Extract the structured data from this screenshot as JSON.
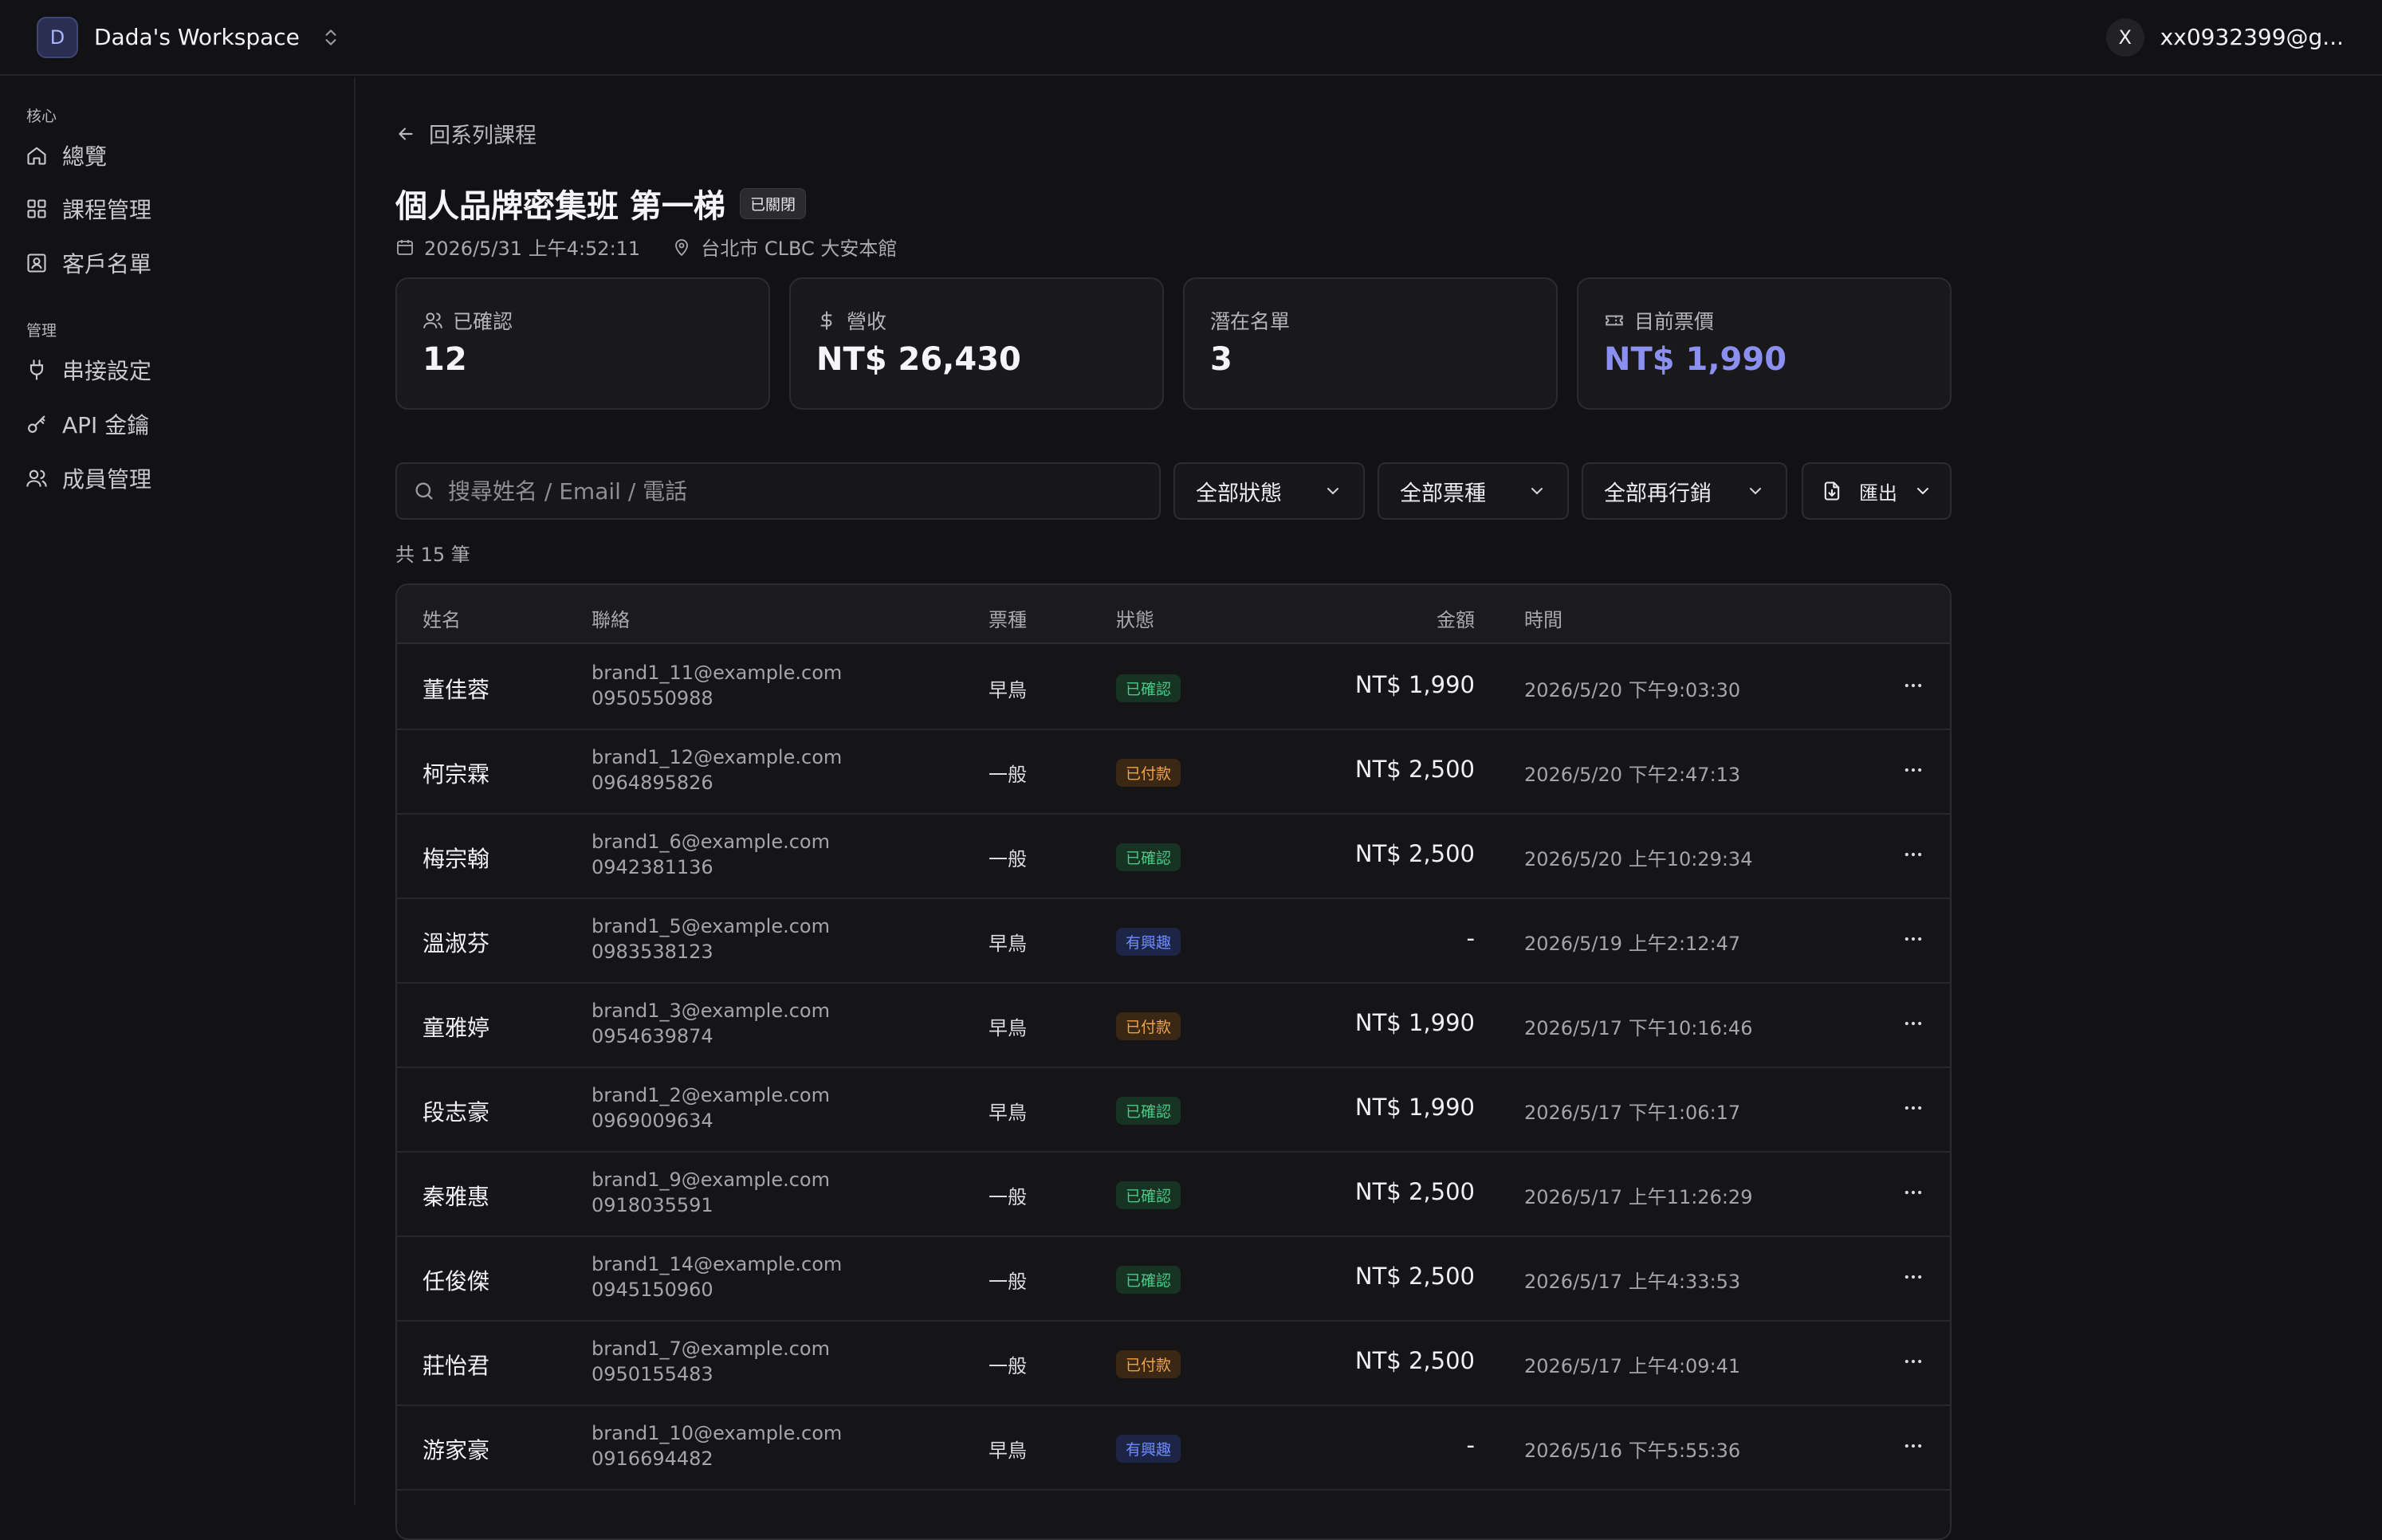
{
  "workspace": {
    "initial": "D",
    "name": "Dada's Workspace"
  },
  "user": {
    "initial": "X",
    "email": "xx0932399@g..."
  },
  "sidebar": {
    "groups": [
      {
        "label": "核心",
        "items": [
          {
            "label": "總覽",
            "icon": "home-icon"
          },
          {
            "label": "課程管理",
            "icon": "grid-icon"
          },
          {
            "label": "客戶名單",
            "icon": "contact-icon"
          }
        ]
      },
      {
        "label": "管理",
        "items": [
          {
            "label": "串接設定",
            "icon": "plug-icon"
          },
          {
            "label": "API 金鑰",
            "icon": "key-icon"
          },
          {
            "label": "成員管理",
            "icon": "users-icon"
          }
        ]
      }
    ]
  },
  "back_label": "回系列課程",
  "course": {
    "title": "個人品牌密集班 第一梯",
    "badge": "已關閉",
    "datetime": "2026/5/31 上午4:52:11",
    "location": "台北市 CLBC 大安本館"
  },
  "stats": [
    {
      "label": "已確認",
      "value": "12",
      "icon": "users-icon"
    },
    {
      "label": "營收",
      "value": "NT$ 26,430",
      "icon": "dollar-icon"
    },
    {
      "label": "潛在名單",
      "value": "3",
      "icon": ""
    },
    {
      "label": "目前票價",
      "value": "NT$ 1,990",
      "icon": "ticket-icon",
      "accent": "#8a8ff0"
    }
  ],
  "filters": {
    "search_placeholder": "搜尋姓名 / Email / 電話",
    "status": "全部狀態",
    "ticket": "全部票種",
    "remarketing": "全部再行銷",
    "export": "匯出"
  },
  "total_label": "共 15 筆",
  "table": {
    "columns": [
      "姓名",
      "聯絡",
      "票種",
      "狀態",
      "金額",
      "時間"
    ],
    "rows": [
      {
        "name": "董佳蓉",
        "email": "brand1_11@example.com",
        "phone": "0950550988",
        "ticket": "早鳥",
        "status": "已確認",
        "status_type": "confirmed",
        "amount": "NT$ 1,990",
        "time": "2026/5/20 下午9:03:30"
      },
      {
        "name": "柯宗霖",
        "email": "brand1_12@example.com",
        "phone": "0964895826",
        "ticket": "一般",
        "status": "已付款",
        "status_type": "paid",
        "amount": "NT$ 2,500",
        "time": "2026/5/20 下午2:47:13"
      },
      {
        "name": "梅宗翰",
        "email": "brand1_6@example.com",
        "phone": "0942381136",
        "ticket": "一般",
        "status": "已確認",
        "status_type": "confirmed",
        "amount": "NT$ 2,500",
        "time": "2026/5/20 上午10:29:34"
      },
      {
        "name": "溫淑芬",
        "email": "brand1_5@example.com",
        "phone": "0983538123",
        "ticket": "早鳥",
        "status": "有興趣",
        "status_type": "interest",
        "amount": "-",
        "time": "2026/5/19 上午2:12:47"
      },
      {
        "name": "童雅婷",
        "email": "brand1_3@example.com",
        "phone": "0954639874",
        "ticket": "早鳥",
        "status": "已付款",
        "status_type": "paid",
        "amount": "NT$ 1,990",
        "time": "2026/5/17 下午10:16:46"
      },
      {
        "name": "段志豪",
        "email": "brand1_2@example.com",
        "phone": "0969009634",
        "ticket": "早鳥",
        "status": "已確認",
        "status_type": "confirmed",
        "amount": "NT$ 1,990",
        "time": "2026/5/17 下午1:06:17"
      },
      {
        "name": "秦雅惠",
        "email": "brand1_9@example.com",
        "phone": "0918035591",
        "ticket": "一般",
        "status": "已確認",
        "status_type": "confirmed",
        "amount": "NT$ 2,500",
        "time": "2026/5/17 上午11:26:29"
      },
      {
        "name": "任俊傑",
        "email": "brand1_14@example.com",
        "phone": "0945150960",
        "ticket": "一般",
        "status": "已確認",
        "status_type": "confirmed",
        "amount": "NT$ 2,500",
        "time": "2026/5/17 上午4:33:53"
      },
      {
        "name": "莊怡君",
        "email": "brand1_7@example.com",
        "phone": "0950155483",
        "ticket": "一般",
        "status": "已付款",
        "status_type": "paid",
        "amount": "NT$ 2,500",
        "time": "2026/5/17 上午4:09:41"
      },
      {
        "name": "游家豪",
        "email": "brand1_10@example.com",
        "phone": "0916694482",
        "ticket": "早鳥",
        "status": "有興趣",
        "status_type": "interest",
        "amount": "-",
        "time": "2026/5/16 下午5:55:36"
      }
    ]
  },
  "colors": {
    "background": "#121214",
    "accent": "#8a8ff0",
    "status_confirmed": "#4cc885",
    "status_paid": "#f0a24a",
    "status_interest": "#6f8cff"
  }
}
